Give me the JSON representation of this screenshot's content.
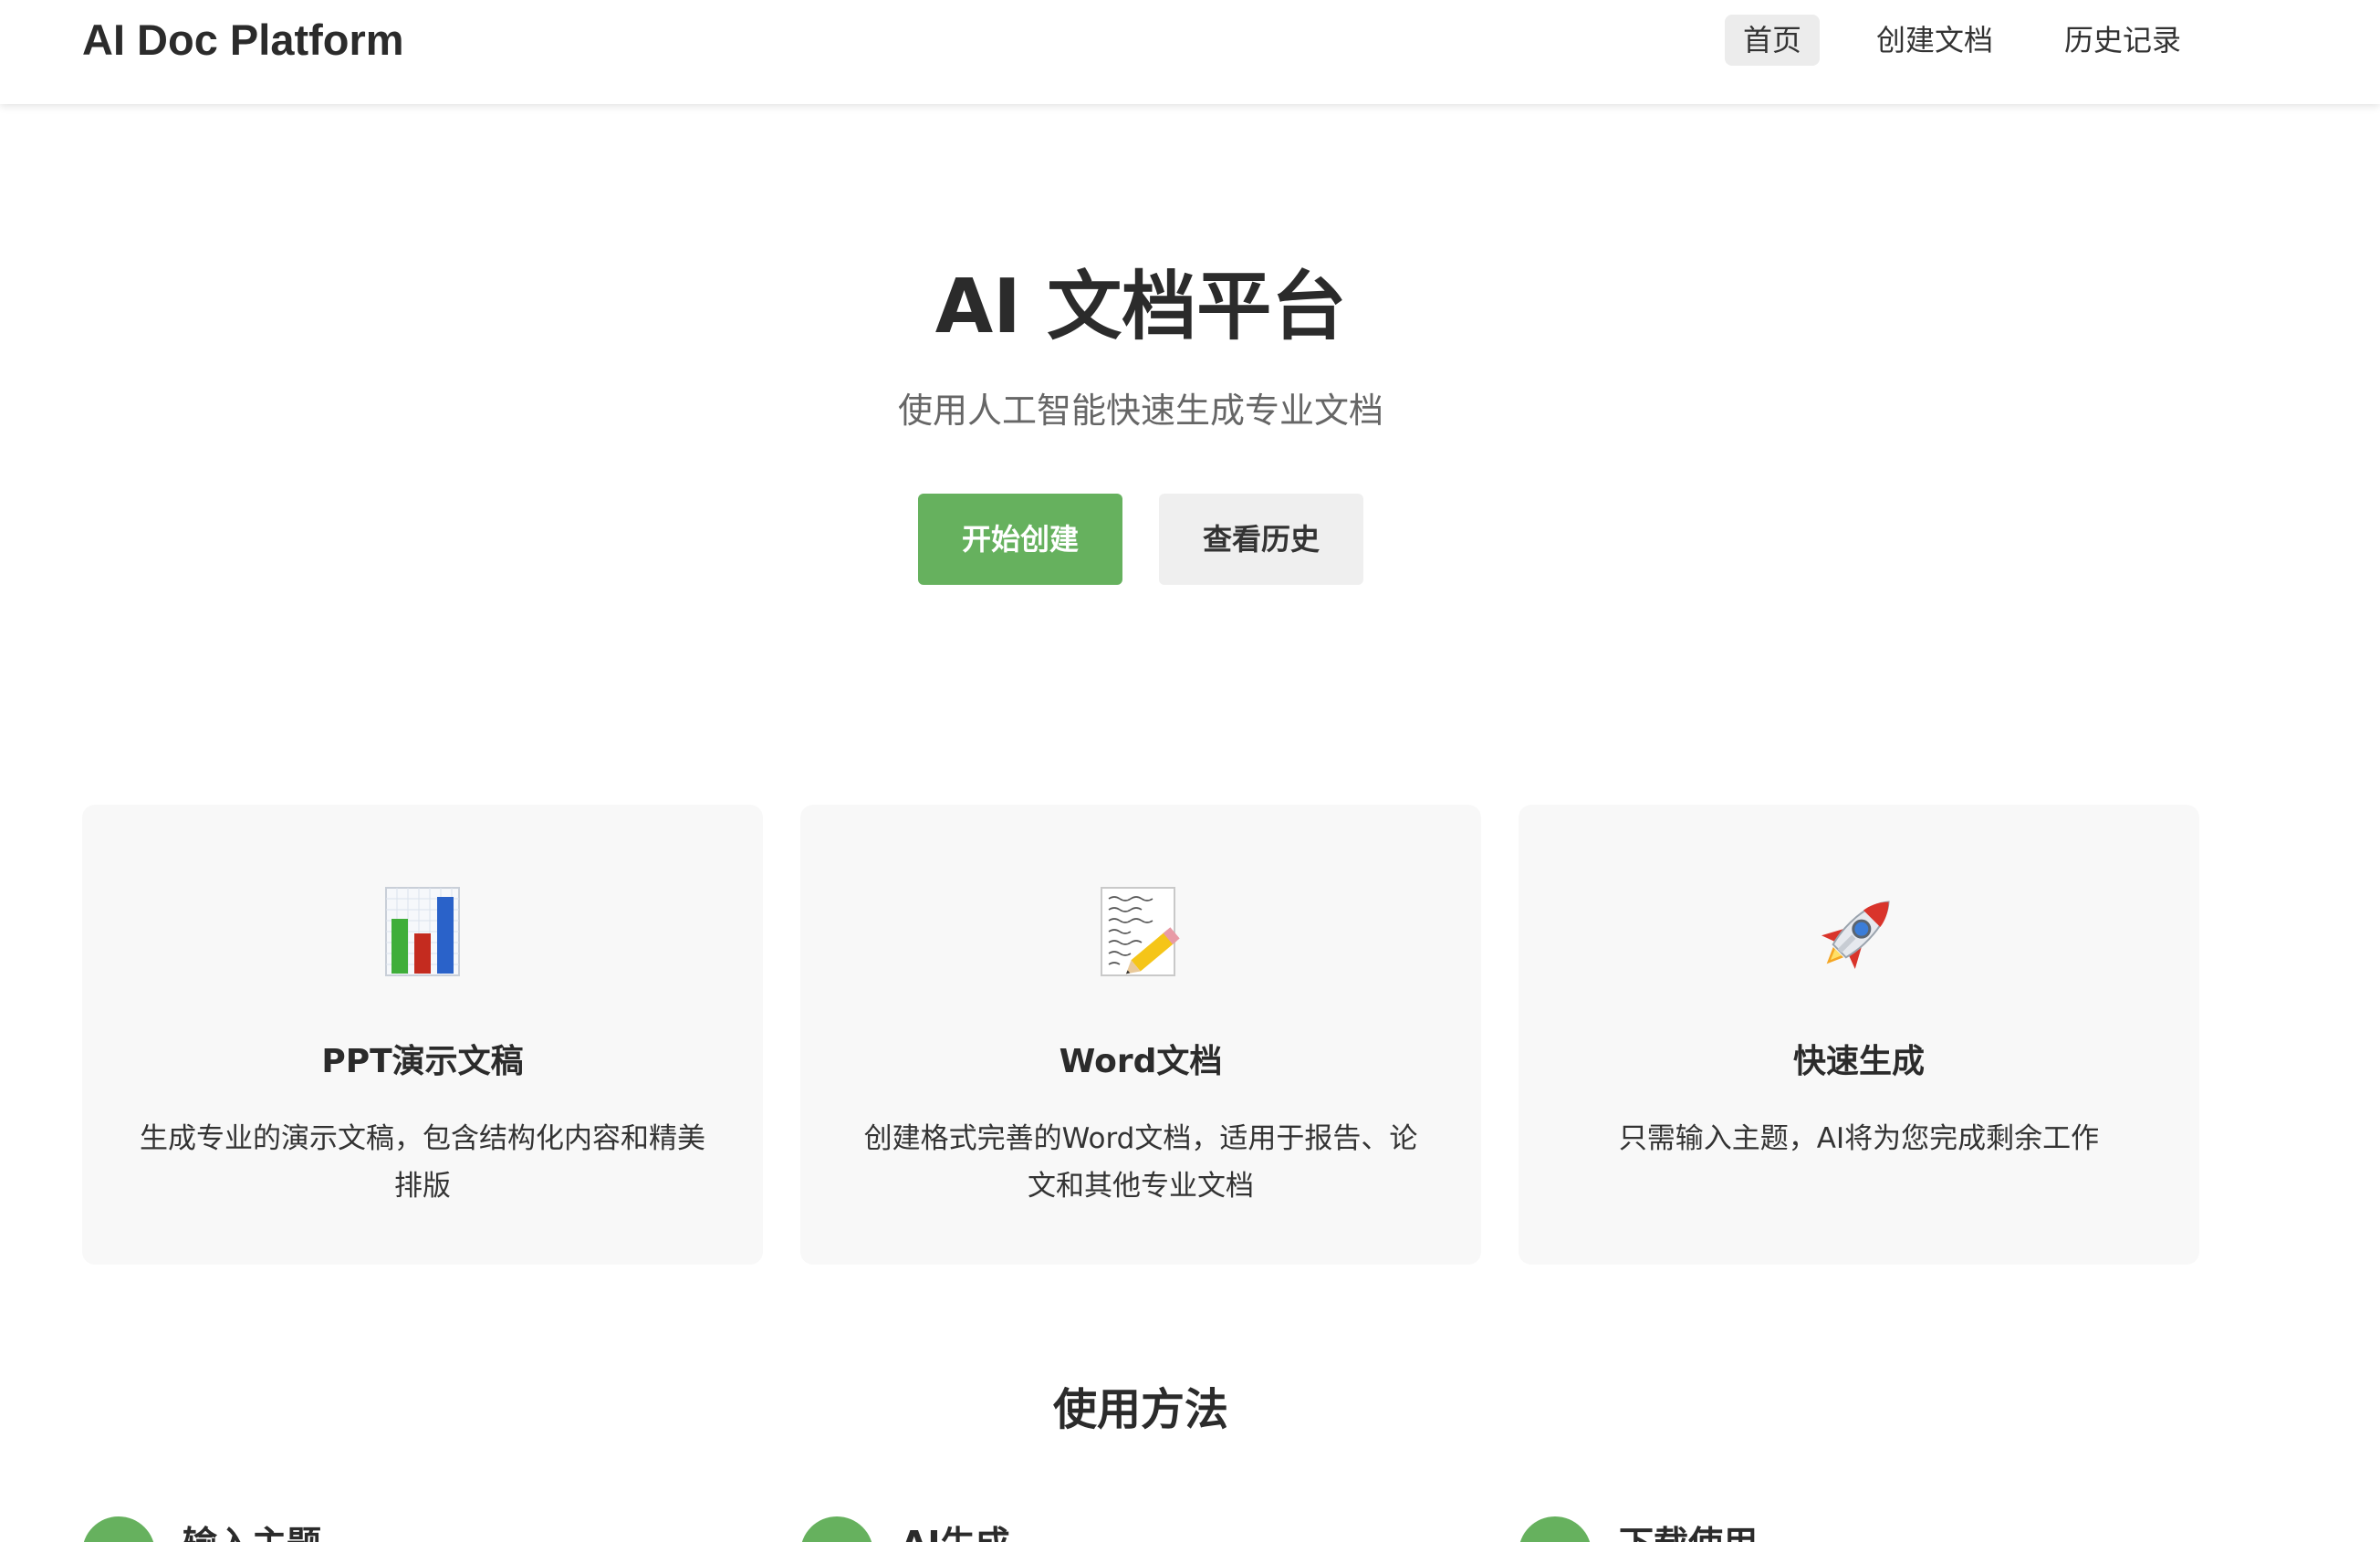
{
  "brand": "AI Doc Platform",
  "nav": {
    "home": "首页",
    "create": "创建文档",
    "history": "历史记录"
  },
  "hero": {
    "title": "AI 文档平台",
    "subtitle": "使用人工智能快速生成专业文档",
    "primary_button": "开始创建",
    "secondary_button": "查看历史"
  },
  "features": [
    {
      "icon": "bar-chart-icon",
      "title": "PPT演示文稿",
      "desc": "生成专业的演示文稿，包含结构化内容和精美排版"
    },
    {
      "icon": "memo-icon",
      "title": "Word文档",
      "desc": "创建格式完善的Word文档，适用于报告、论文和其他专业文档"
    },
    {
      "icon": "rocket-icon",
      "title": "快速生成",
      "desc": "只需输入主题，AI将为您完成剩余工作"
    }
  ],
  "usage": {
    "title": "使用方法",
    "steps": [
      {
        "title": "输入主题"
      },
      {
        "title": "AI生成"
      },
      {
        "title": "下载使用"
      }
    ]
  },
  "colors": {
    "accent": "#66b15e",
    "card_bg": "#f8f8f8",
    "secondary_bg": "#efefef"
  }
}
